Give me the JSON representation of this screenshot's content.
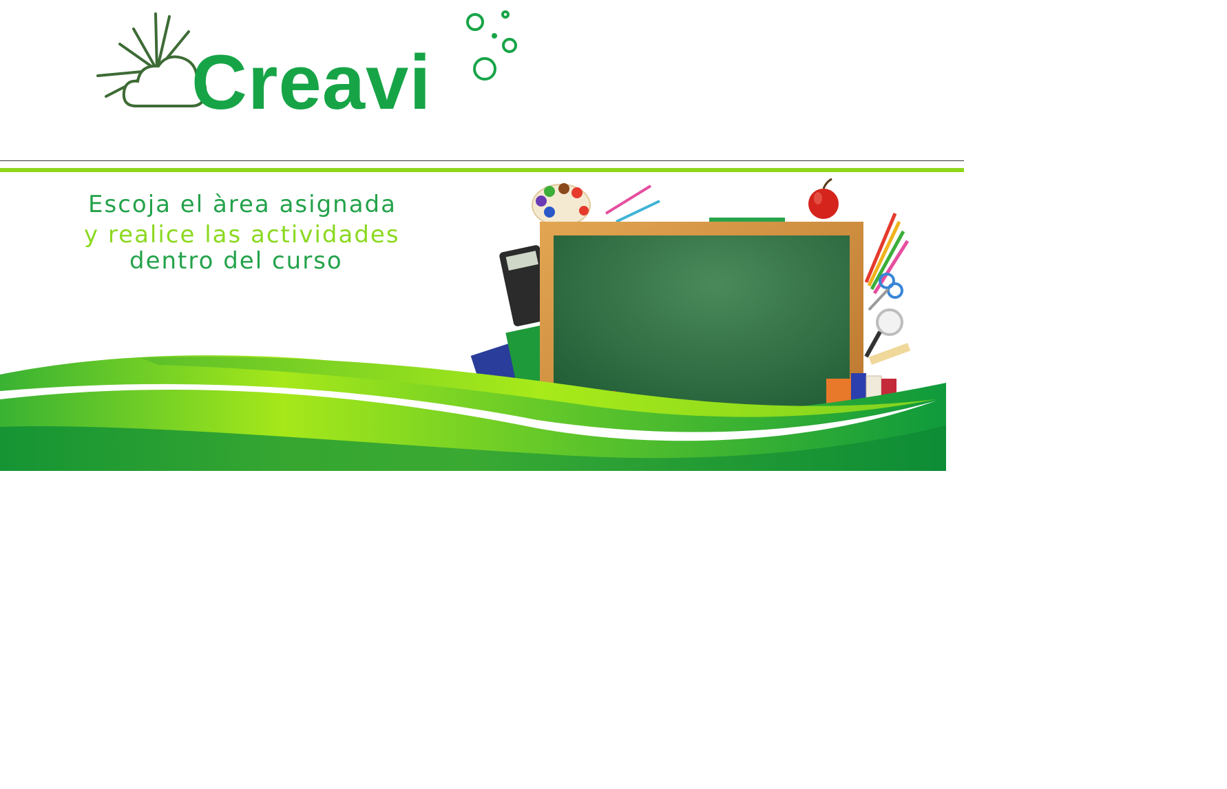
{
  "brand": {
    "name": "Creavi",
    "colors": {
      "primary": "#17a447",
      "accent": "#8fd61c",
      "sun_icon": "#3d6b35"
    },
    "icons": [
      "sun-cloud-icon",
      "bubbles-icon"
    ]
  },
  "banner": {
    "line1": "Escoja el àrea asignada",
    "line2": "y realice las actividades",
    "line3": "dentro del curso",
    "illustration": "chalkboard-school-supplies"
  }
}
